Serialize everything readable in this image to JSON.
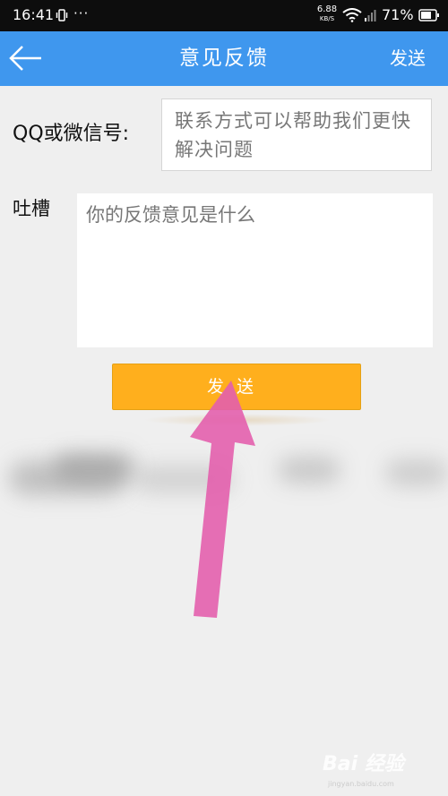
{
  "status_bar": {
    "time": "16:41",
    "more_indicator": "···",
    "net_speed_value": "6.88",
    "net_speed_unit": "KB/S",
    "battery_percent": "71%"
  },
  "header": {
    "title": "意见反馈",
    "send_label": "发送",
    "back_icon": "arrow-left-icon",
    "background_color": "#3f97ee"
  },
  "form": {
    "contact_label": "QQ或微信号:",
    "contact_placeholder": "联系方式可以帮助我们更快解决问题",
    "complaint_label": "吐槽",
    "feedback_placeholder": "你的反馈意见是什么"
  },
  "send_button": {
    "label": "发送",
    "color": "#ffaf1d"
  },
  "overlay": {
    "annotation": "pink-pointer-arrow-icon",
    "arrow_color": "#e35fad"
  },
  "watermark": {
    "brand": "Bai 经验",
    "sub": "jingyan.baidu.com"
  }
}
